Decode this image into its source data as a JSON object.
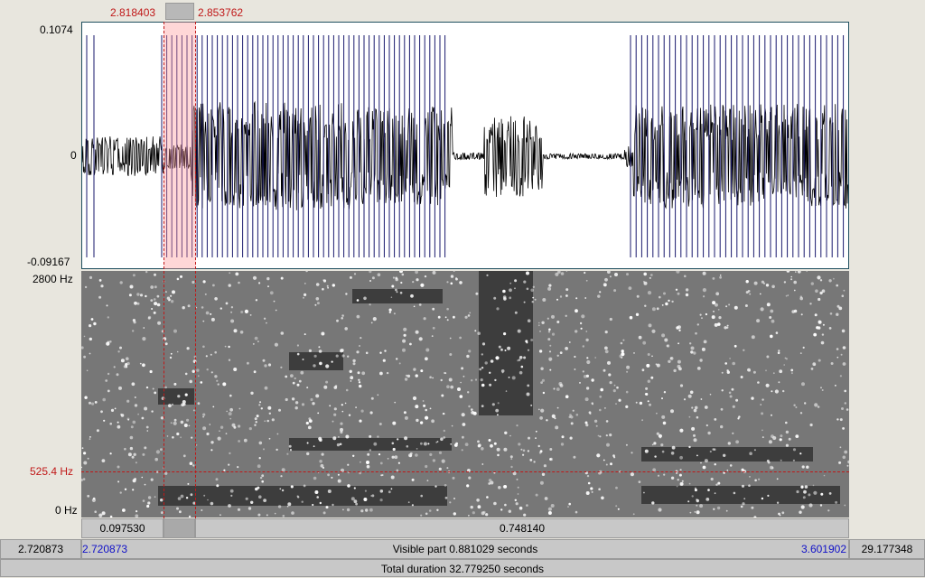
{
  "selection": {
    "start": "2.818403",
    "end": "2.853762"
  },
  "waveform": {
    "max_label": "0.1074",
    "zero_label": "0",
    "min_label": "-0.09167"
  },
  "spectrogram": {
    "top_label": "2800 Hz",
    "cursor_label": "525.4 Hz",
    "bottom_label": "0 Hz"
  },
  "segments": {
    "left": "0.097530",
    "right": "0.748140"
  },
  "visible": {
    "left_time": "2.720873",
    "start": "2.720873",
    "label": "Visible part 0.881029 seconds",
    "end": "3.601902",
    "right_time": "29.177348"
  },
  "total": {
    "label": "Total duration 32.779250 seconds"
  },
  "colors": {
    "selection": "#ffb4b4",
    "cursor": "#c01818",
    "pulse": "#1a1a6e",
    "wave": "#000000"
  }
}
